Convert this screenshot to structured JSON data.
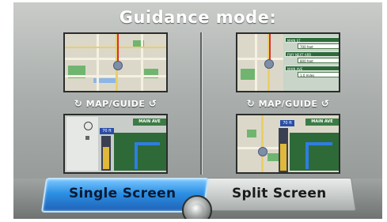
{
  "header": {
    "title": "Guidance mode:"
  },
  "single_screen": {
    "map_guide_label": "MAP/GUIDE",
    "arrow_left": "↻",
    "arrow_right": "↺",
    "guide_street": "MAIN AVE",
    "guide_distance": "70 ft"
  },
  "split_screen": {
    "map_guide_label": "MAP/GUIDE",
    "arrow_left": "↻",
    "arrow_right": "↺",
    "guide_street": "MAIN AVE",
    "guide_distance": "70 ft",
    "turn_list": [
      {
        "street": "MAIN ST",
        "distance": "700 feet"
      },
      {
        "street": "FWY NEXT ARR",
        "distance": "800 feet"
      },
      {
        "street": "MAIN AVE",
        "distance": "1.0 miles"
      }
    ]
  },
  "buttons": {
    "single": "Single Screen",
    "split": "Split Screen"
  },
  "colors": {
    "selected_button": "#2b8fe3",
    "unselected_button": "#c7cbc9",
    "background": "#a9adab",
    "guide_green": "#3b7c45"
  }
}
